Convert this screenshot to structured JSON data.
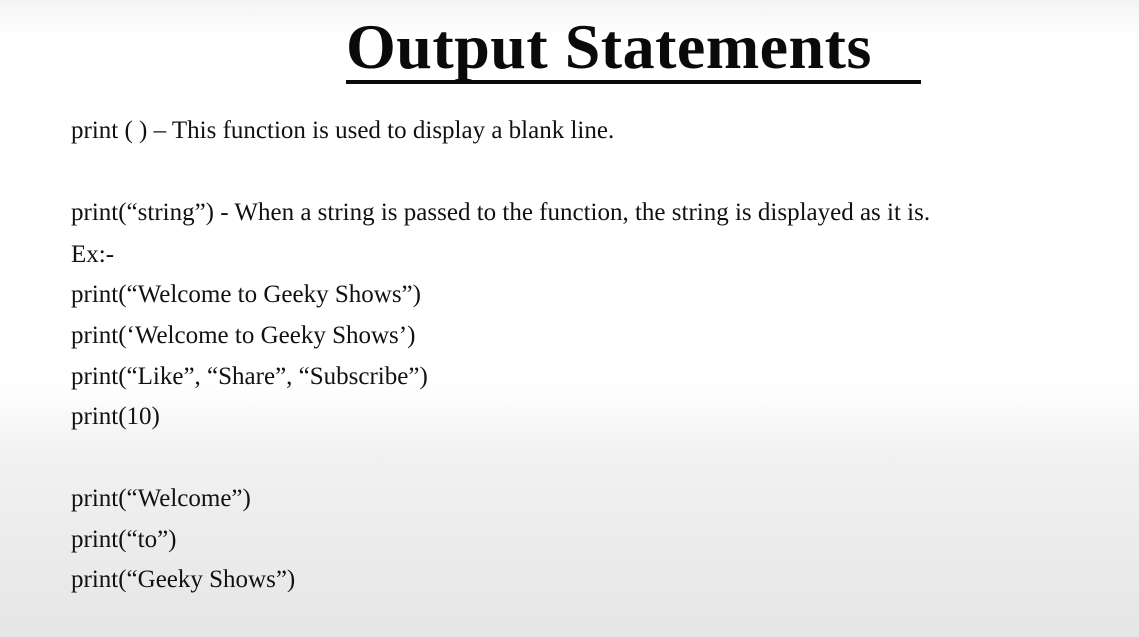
{
  "slide": {
    "title": "Output Statements",
    "lines": [
      "print ( ) – This function is used to display a blank line.",
      "print(“string”) -  When a string is passed to the function, the string is displayed as it is.",
      "Ex:-",
      "print(“Welcome to Geeky Shows”)",
      "print(‘Welcome to Geeky Shows’)",
      "print(“Like”, “Share”, “Subscribe”)",
      "print(10)",
      "print(“Welcome”)",
      "print(“to”)",
      "print(“Geeky Shows”)"
    ]
  }
}
